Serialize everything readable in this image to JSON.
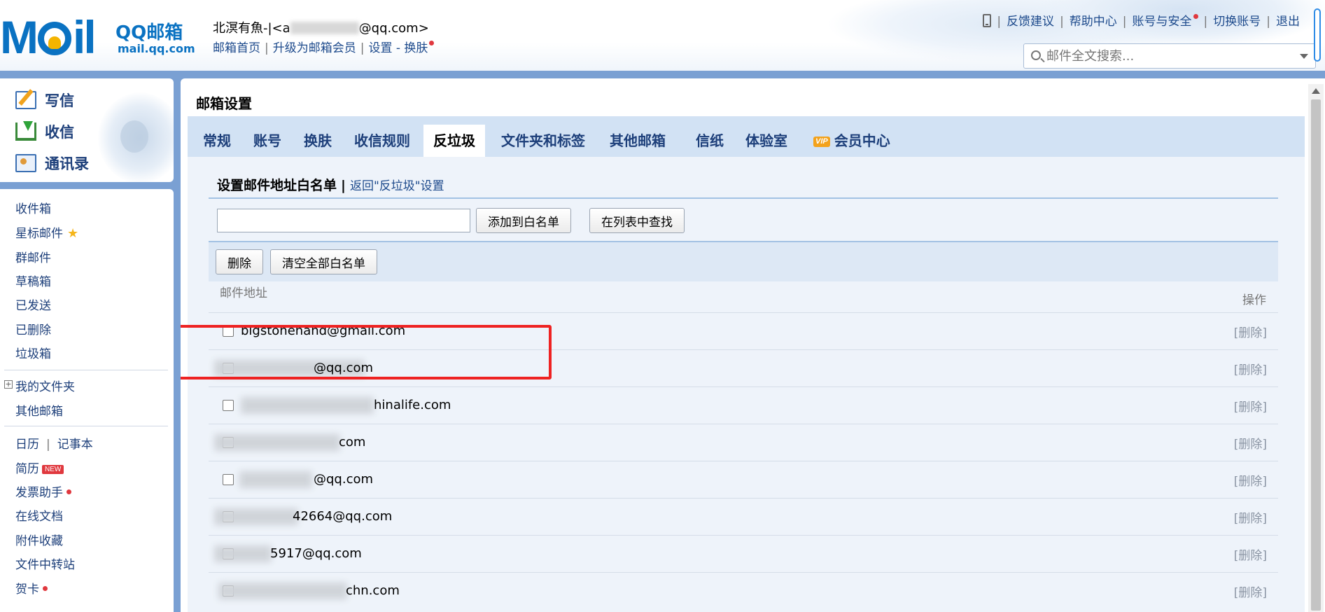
{
  "header": {
    "logo_mark": "M",
    "logo_mark_tail": "il",
    "logo_name": "QQ邮箱",
    "logo_domain": "mail.qq.com",
    "user_name": "北溟有魚-|<a",
    "user_email_suffix": "@qq.com>",
    "nav": [
      "邮箱首页",
      "升级为邮箱会员",
      "设置",
      "换肤"
    ],
    "top_links": [
      "反馈建议",
      "帮助中心",
      "账号与安全",
      "切换账号",
      "退出"
    ],
    "search_placeholder": "邮件全文搜索..."
  },
  "sidebar": {
    "quick": [
      "写信",
      "收信",
      "通讯录"
    ],
    "folders": [
      "收件箱",
      "星标邮件",
      "群邮件",
      "草稿箱",
      "已发送",
      "已删除",
      "垃圾箱"
    ],
    "my_folders": "我的文件夹",
    "other_mailbox": "其他邮箱",
    "calendar": "日历",
    "notebook": "记事本",
    "resume": "简历",
    "new_badge": "NEW",
    "tools": [
      "发票助手",
      "在线文档",
      "附件收藏",
      "文件中转站",
      "贺卡"
    ]
  },
  "main": {
    "title": "邮箱设置",
    "tabs": [
      "常规",
      "账号",
      "换肤",
      "收信规则",
      "反垃圾",
      "文件夹和标签",
      "其他邮箱",
      "信纸",
      "体验室",
      "会员中心"
    ],
    "active_tab": "反垃圾",
    "vip_label": "VIP",
    "heading": "设置邮件地址白名单",
    "heading_sep": "|",
    "back_link": "返回\"反垃圾\"设置",
    "add_button": "添加到白名单",
    "find_button": "在列表中查找",
    "delete_button": "删除",
    "clear_button": "清空全部白名单",
    "col_address": "邮件地址",
    "col_action": "操作",
    "rows": [
      {
        "address": "bigstonehand@gmail.com",
        "action": "[删除]"
      },
      {
        "address": "@qq.com",
        "action": "[删除]"
      },
      {
        "address": "hinalife.com",
        "action": "[删除]"
      },
      {
        "address": "com",
        "action": "[删除]"
      },
      {
        "address": "@qq.com",
        "action": "[删除]"
      },
      {
        "address": "42664@qq.com",
        "action": "[删除]"
      },
      {
        "address": "5917@qq.com",
        "action": "[删除]"
      },
      {
        "address": "chn.com",
        "action": "[删除]"
      }
    ]
  },
  "colors": {
    "accent": "#7aa0d3",
    "link": "#1d4a8c",
    "highlight_box": "#ee2222"
  }
}
